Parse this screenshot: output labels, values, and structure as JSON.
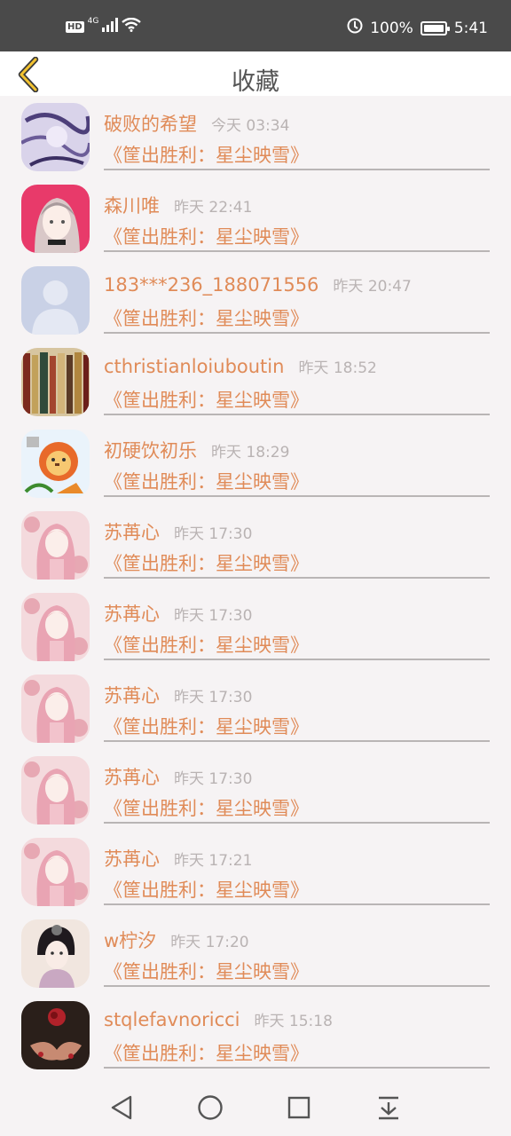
{
  "status_bar": {
    "hd": "HD",
    "network": "4G",
    "battery_percent": "100%",
    "battery_level": 1.0,
    "time": "5:41"
  },
  "header": {
    "title": "收藏",
    "back_icon": "chevron-left-icon"
  },
  "colors": {
    "accent": "#e08b58",
    "time_gray": "#b9b3b3",
    "divider": "#b9b5b5",
    "back_yellow": "#f2c230"
  },
  "favorites": [
    {
      "user": "破败的希望",
      "time": "今天 03:34",
      "book": "《筐出胜利：星尘映雪》",
      "avatar": "purple-ink-art"
    },
    {
      "user": "森川唯",
      "time": "昨天 22:41",
      "book": "《筐出胜利：星尘映雪》",
      "avatar": "anime-girl-pink"
    },
    {
      "user": "183***236_188071556",
      "time": "昨天 20:47",
      "book": "《筐出胜利：星尘映雪》",
      "avatar": "default-silhouette"
    },
    {
      "user": "cthristianloiuboutin",
      "time": "昨天 18:52",
      "book": "《筐出胜利：星尘映雪》",
      "avatar": "book-spines"
    },
    {
      "user": "初硬饮初乐",
      "time": "昨天 18:29",
      "book": "《筐出胜利：星尘映雪》",
      "avatar": "cartoon-lion"
    },
    {
      "user": "苏苒心",
      "time": "昨天 17:30",
      "book": "《筐出胜利：星尘映雪》",
      "avatar": "pink-hair-girl"
    },
    {
      "user": "苏苒心",
      "time": "昨天 17:30",
      "book": "《筐出胜利：星尘映雪》",
      "avatar": "pink-hair-girl"
    },
    {
      "user": "苏苒心",
      "time": "昨天 17:30",
      "book": "《筐出胜利：星尘映雪》",
      "avatar": "pink-hair-girl"
    },
    {
      "user": "苏苒心",
      "time": "昨天 17:30",
      "book": "《筐出胜利：星尘映雪》",
      "avatar": "pink-hair-girl"
    },
    {
      "user": "苏苒心",
      "time": "昨天 17:21",
      "book": "《筐出胜利：星尘映雪》",
      "avatar": "pink-hair-girl"
    },
    {
      "user": "w柠汐",
      "time": "昨天 17:20",
      "book": "《筐出胜利：星尘映雪》",
      "avatar": "ancient-style-girl"
    },
    {
      "user": "stqlefavnoricci",
      "time": "昨天 15:18",
      "book": "《筐出胜利：星尘映雪》",
      "avatar": "rose-hands"
    }
  ],
  "nav_bar": {
    "back": "triangle-back-icon",
    "home": "circle-home-icon",
    "recents": "square-recents-icon",
    "extra": "download-arrow-icon"
  }
}
